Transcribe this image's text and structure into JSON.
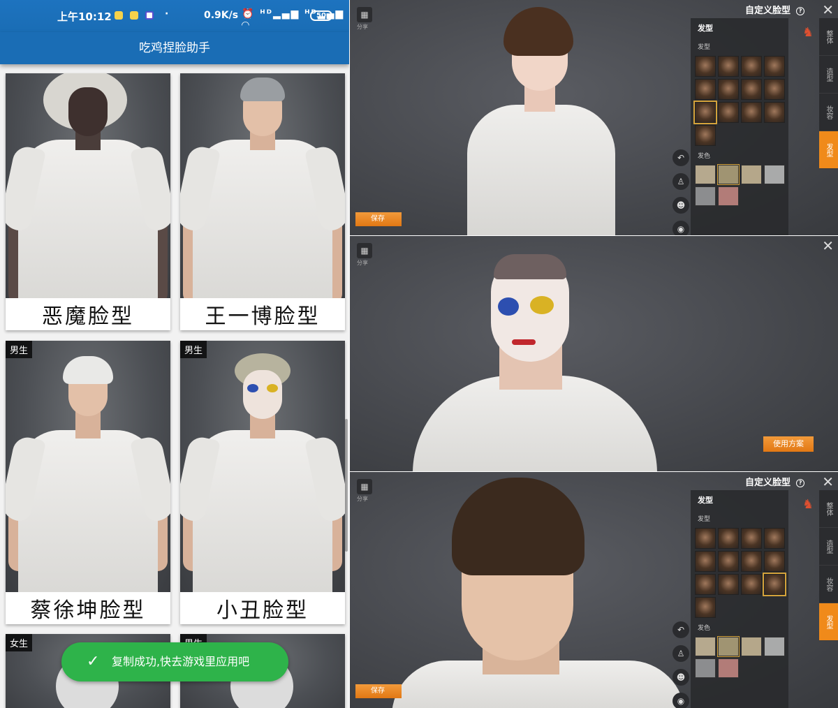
{
  "phone": {
    "status": {
      "time": "上午10:12",
      "dot": "·",
      "speed": "0.9K/s",
      "icons": "⏰ ᴴᴰ▂▄▆ ᴴᴰ▂▄▆ ◠",
      "battery": "50"
    },
    "app_title": "吃鸡捏脸助手",
    "cards": [
      {
        "caption": "恶魔脸型",
        "tag": ""
      },
      {
        "caption": "王一博脸型",
        "tag": ""
      },
      {
        "caption": "蔡徐坤脸型",
        "tag": "男生"
      },
      {
        "caption": "小丑脸型",
        "tag": "男生"
      },
      {
        "caption": "",
        "tag": "女生"
      },
      {
        "caption": "",
        "tag": "男生"
      }
    ],
    "toast": {
      "icon": "checkmark-icon",
      "text": "复制成功,快去游戏里应用吧"
    }
  },
  "game": {
    "panels": [
      {
        "top_left_btn_caption": "分享",
        "header": "自定义脸型",
        "help": "?",
        "section_title": "发型",
        "hair_label": "发型",
        "color_label": "发色",
        "save_label": "保存",
        "side_tabs": [
          "整体",
          "造型",
          "妆容",
          "发型"
        ],
        "active_tab": 3,
        "selected_hair": 8,
        "hair_colors": [
          "#b6a98e",
          "#a09472",
          "#b5a78a",
          "#a9aaaa",
          "#8c8d8f",
          "#b27c78"
        ]
      },
      {
        "top_left_btn_caption": "分享",
        "use_label": "使用方案"
      },
      {
        "top_left_btn_caption": "分享",
        "header": "自定义脸型",
        "help": "?",
        "section_title": "发型",
        "hair_label": "发型",
        "color_label": "发色",
        "save_label": "保存",
        "side_tabs": [
          "整体",
          "造型",
          "妆容",
          "发型"
        ],
        "active_tab": 3,
        "selected_hair": 11,
        "hair_colors": [
          "#b6a98e",
          "#a09472",
          "#b5a78a",
          "#a9aaaa",
          "#8c8d8f",
          "#b27c78"
        ]
      }
    ],
    "close_symbol": "✕",
    "tool_icons": [
      "undo-icon",
      "body-icon",
      "head-icon",
      "camera-icon"
    ]
  }
}
